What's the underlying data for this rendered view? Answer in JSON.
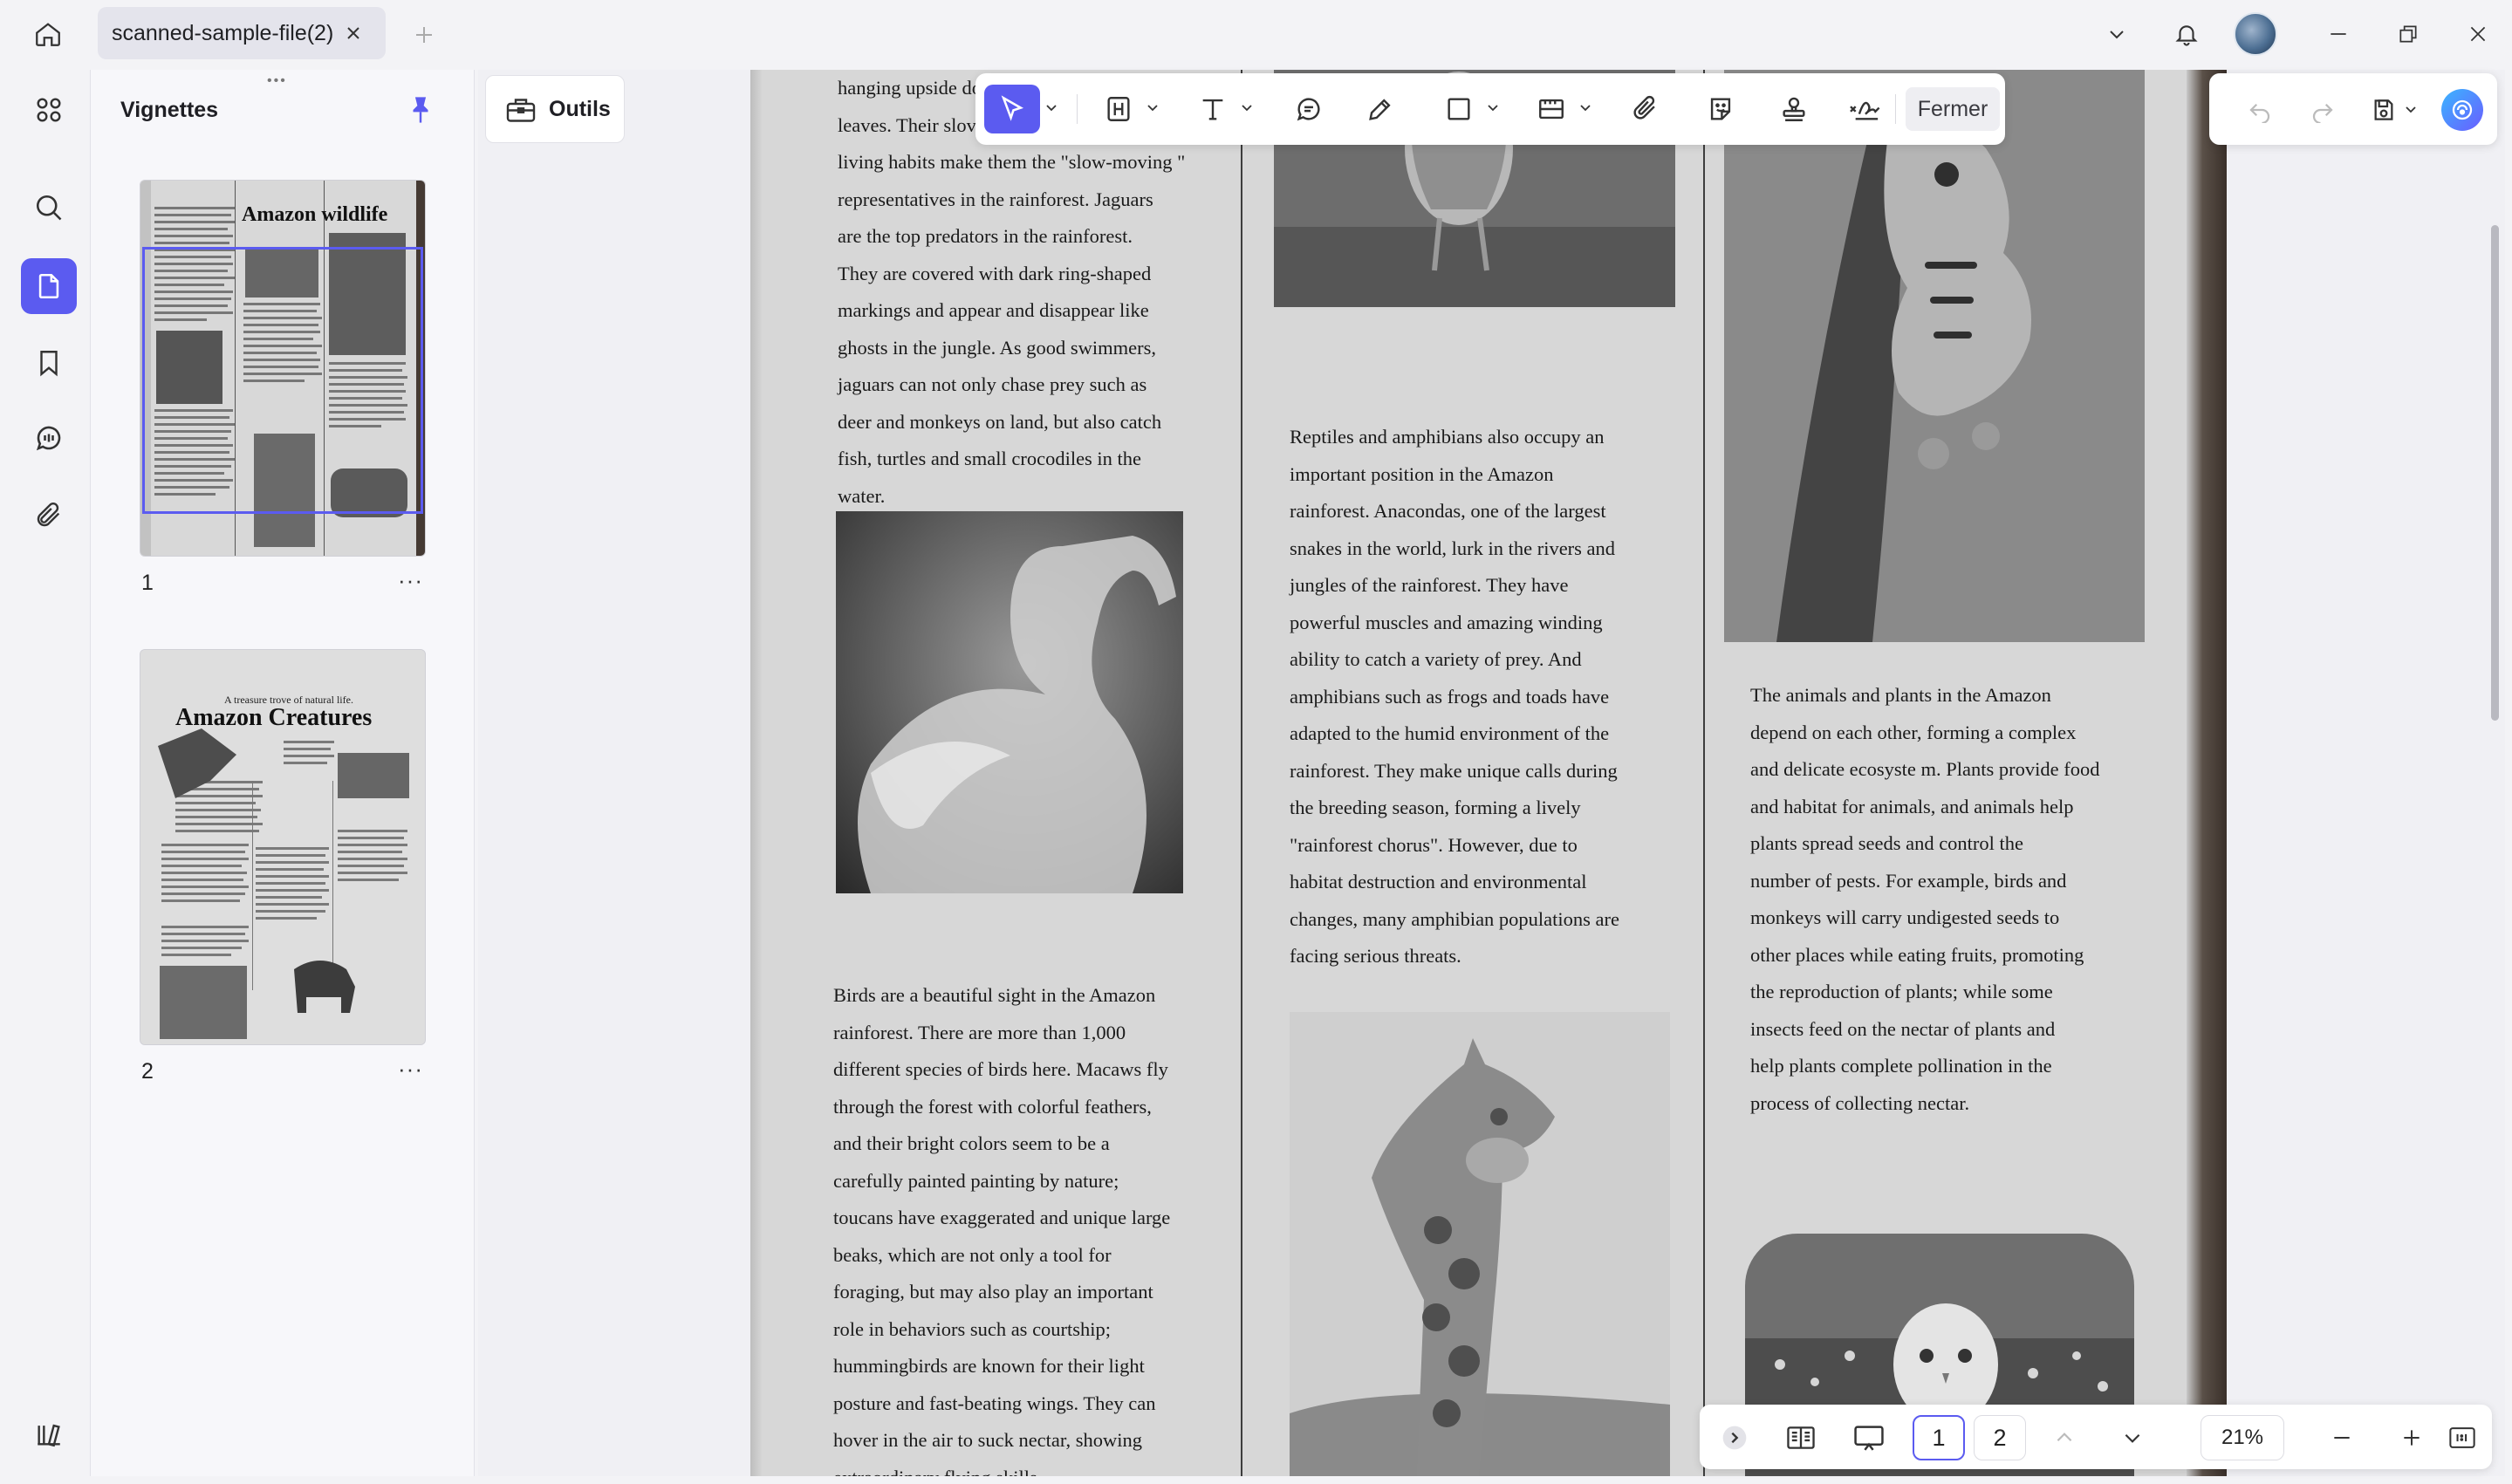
{
  "tab": {
    "title": "scanned-sample-file(2)"
  },
  "thumbnails": {
    "title": "Vignettes",
    "pages": [
      {
        "number": "1",
        "heading": "Amazon wildlife"
      },
      {
        "number": "2",
        "subheading": "A treasure trove of natural life.",
        "heading": "Amazon Creatures"
      }
    ],
    "more": "···"
  },
  "tools": {
    "outils_label": "Outils",
    "close_label": "Fermer"
  },
  "document": {
    "col1_top_lines": [
      "hanging upside do",
      "leaves. Their slov",
      "living habits make them the \"slow-moving \"",
      "representatives in the rainforest. Jaguars",
      "are the top predators in the rainforest.",
      "They are covered with dark ring-shaped",
      "markings and appear and disappear like",
      "ghosts in the jungle. As good swimmers,",
      "jaguars can not only chase prey such as",
      "deer and monkeys on land, but also catch",
      "fish, turtles and small crocodiles in the",
      "water."
    ],
    "col1_birds_lines": [
      "Birds are a beautiful sight in the Amazon",
      "rainforest.  There  are  more  than  1,000",
      "different species of birds here. Macaws fly",
      "through the forest with colorful feathers,",
      "and their bright colors seem to be a",
      "carefully painted painting by nature;",
      "toucans have exaggerated and unique large",
      "beaks, which are not  only a tool for",
      "foraging, but may also play an important",
      "role in behaviors such as courtship;",
      "hummingbirds are known for their light",
      "posture and fast-beating wings. They can",
      "hover in the air to suck nectar, showing",
      "extraordinary flying skills."
    ],
    "col2_lines": [
      "Reptiles and amphibians also occupy an",
      "important position in the Amazon",
      "rainforest. Anacondas, one of the largest",
      "snakes in the world, lurk in the rivers and",
      "jungles of the rainforest. They have",
      "powerful muscles and amazing winding",
      "ability to catch a variety of prey. And",
      "amphibians such as frogs and toads have",
      "adapted to the humid environment of the",
      "rainforest. They make unique calls during",
      "the breeding season, forming a lively",
      "\"rainforest chorus\". However, due to",
      "habitat destruction and environmental",
      "changes, many amphibian populations are",
      "facing serious threats."
    ],
    "col3_lines": [
      "The animals and plants in the Amazon",
      "depend on each other, forming a complex",
      "and delicate ecosyste  m. Plants provide food",
      "and habitat for animals, and animals help",
      "plants spread seeds and control the",
      "number of pests. For example, birds and",
      "monkeys will carry undigested seeds to",
      "other places while eating fruits, promoting",
      "the reproduction of plants; while some",
      "insects feed on the nectar of plants and",
      "help plants complete pollination in the",
      "process of collecting nectar."
    ]
  },
  "navigation": {
    "pages": [
      "1",
      "2"
    ],
    "current_page": "1",
    "zoom": "21%"
  },
  "colors": {
    "accent": "#5b5bf0",
    "background": "#f3f3f6",
    "panel": "#f7f7fa"
  }
}
